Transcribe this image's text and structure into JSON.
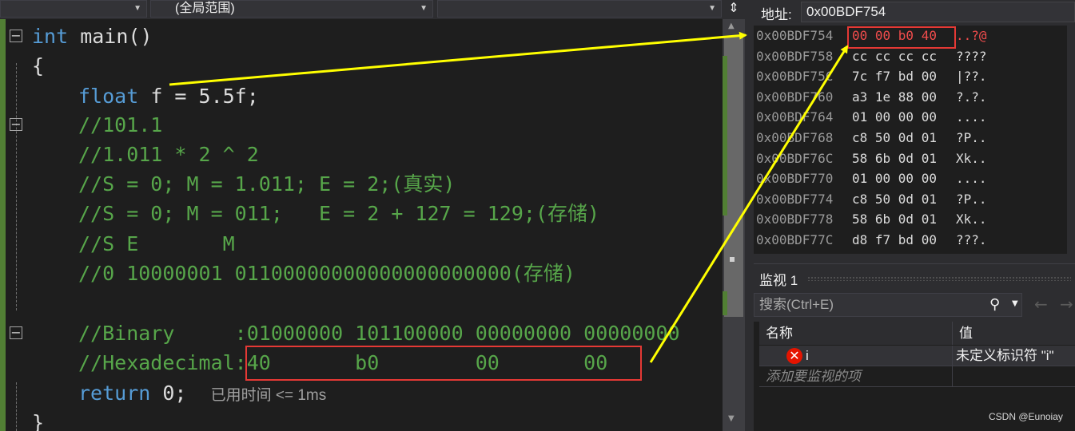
{
  "toolbar": {
    "dropdown1": "",
    "dropdown2": "(全局范围)",
    "dropdown3": "",
    "split_icon": "split-icon"
  },
  "code": {
    "l1_kw": "int",
    "l1_rest": " main()",
    "l2": "{",
    "l3_kw": "float",
    "l3_rest": " f = 5.5f;",
    "l4": "//101.1",
    "l5": "//1.011 * 2 ^ 2",
    "l6": "//S = 0; M = 1.011; E = 2;(真实)",
    "l7": "//S = 0; M = 011;   E = 2 + 127 = 129;(存储)",
    "l8": "//S E       M",
    "l9": "//0 10000001 01100000000000000000000(存储)",
    "l11": "//Binary     :01000000 101100000 00000000 00000000",
    "l12": "//Hexadecimal:40       b0        00       00",
    "l13_kw": "return",
    "l13_rest": " 0;",
    "l13_hint": "已用时间 <= 1ms",
    "l14": "}"
  },
  "memory": {
    "address_label": "地址:",
    "address_value": "0x00BDF754",
    "rows": [
      {
        "addr": "0x00BDF754",
        "bytes": "00 00 b0 40",
        "ascii": "..?@"
      },
      {
        "addr": "0x00BDF758",
        "bytes": "cc cc cc cc",
        "ascii": "????"
      },
      {
        "addr": "0x00BDF75C",
        "bytes": "7c f7 bd 00",
        "ascii": "|??."
      },
      {
        "addr": "0x00BDF760",
        "bytes": "a3 1e 88 00",
        "ascii": "?.?."
      },
      {
        "addr": "0x00BDF764",
        "bytes": "01 00 00 00",
        "ascii": "...."
      },
      {
        "addr": "0x00BDF768",
        "bytes": "c8 50 0d 01",
        "ascii": "?P.."
      },
      {
        "addr": "0x00BDF76C",
        "bytes": "58 6b 0d 01",
        "ascii": "Xk.."
      },
      {
        "addr": "0x00BDF770",
        "bytes": "01 00 00 00",
        "ascii": "...."
      },
      {
        "addr": "0x00BDF774",
        "bytes": "c8 50 0d 01",
        "ascii": "?P.."
      },
      {
        "addr": "0x00BDF778",
        "bytes": "58 6b 0d 01",
        "ascii": "Xk.."
      },
      {
        "addr": "0x00BDF77C",
        "bytes": "d8 f7 bd 00",
        "ascii": "???."
      }
    ]
  },
  "watch": {
    "title": "监视 1",
    "search_placeholder": "搜索(Ctrl+E)",
    "col_name": "名称",
    "col_value": "值",
    "row_name": "i",
    "row_value": "未定义标识符 \"i\"",
    "add_item": "添加要监视的项"
  },
  "watermark": "CSDN @Eunoiay",
  "colors": {
    "keyword": "#569cd6",
    "comment": "#57a64a",
    "annotation_red": "#e53935",
    "annotation_arrow": "#ffff00"
  }
}
